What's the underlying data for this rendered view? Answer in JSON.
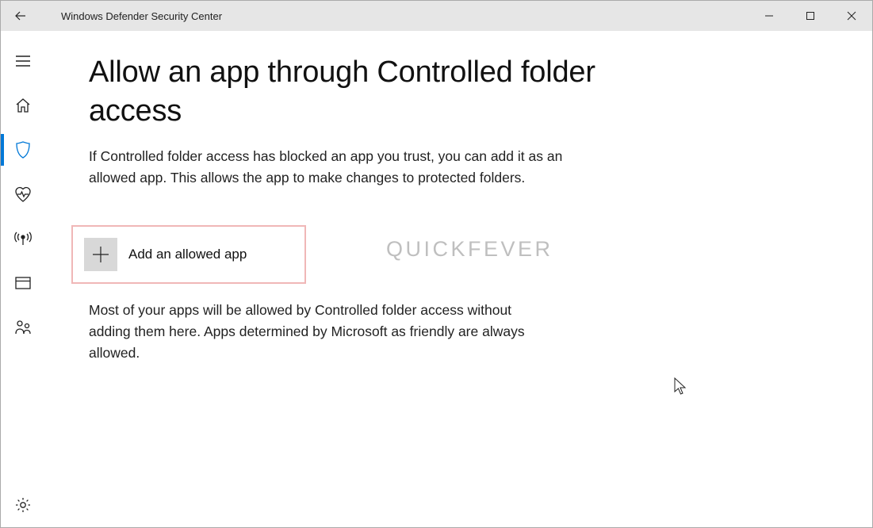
{
  "titlebar": {
    "app_title": "Windows Defender Security Center"
  },
  "page": {
    "title": "Allow an app through Controlled folder access",
    "description": "If Controlled folder access has blocked an app you trust, you can add it as an allowed app. This allows the app to make changes to protected folders.",
    "add_button_label": "Add an allowed app",
    "note": "Most of your apps will be allowed by Controlled folder access without adding them here. Apps determined by Microsoft as friendly are always allowed."
  },
  "watermark": "QUICKFEVER"
}
